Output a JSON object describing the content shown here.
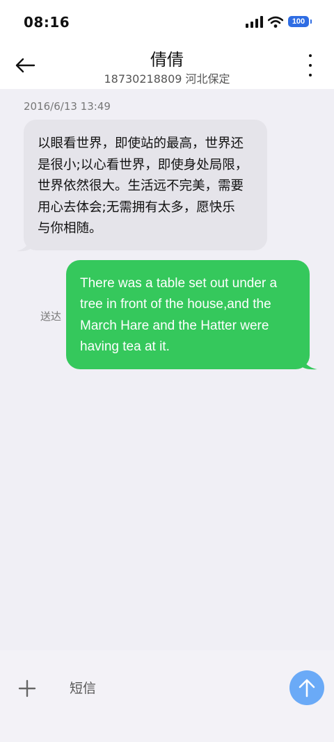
{
  "status_bar": {
    "time": "08:16",
    "battery_level": "100",
    "icons": [
      "signal-icon",
      "wifi-icon",
      "battery-icon"
    ]
  },
  "header": {
    "contact_name": "倩倩",
    "contact_subtitle": "18730218809 河北保定",
    "back_icon": "arrow-left-icon",
    "menu_icon": "more-vertical-icon"
  },
  "conversation": {
    "timestamp": "2016/6/13 13:49",
    "messages": [
      {
        "direction": "incoming",
        "lines": [
          "以眼看世界，即使站的最高，世界还",
          "是很小;以心看世界，即使身处局限，",
          "世界依然很大。生活远不完美，需要",
          "用心去体会;无需拥有太多，愿快乐",
          "与你相随。"
        ]
      },
      {
        "direction": "outgoing",
        "status": "送达",
        "lines": [
          "There was a table set out under a",
          "tree in front of the house,and the",
          "March Hare and the Hatter were",
          "having tea at it."
        ]
      }
    ]
  },
  "composer": {
    "placeholder": "短信",
    "add_icon": "plus-icon",
    "send_icon": "arrow-up-icon"
  },
  "colors": {
    "background": "#f0eff5",
    "incoming_bubble": "#e5e4ea",
    "outgoing_bubble": "#35c85c",
    "send_button": "#6aaaf7",
    "battery": "#2f6de3"
  }
}
